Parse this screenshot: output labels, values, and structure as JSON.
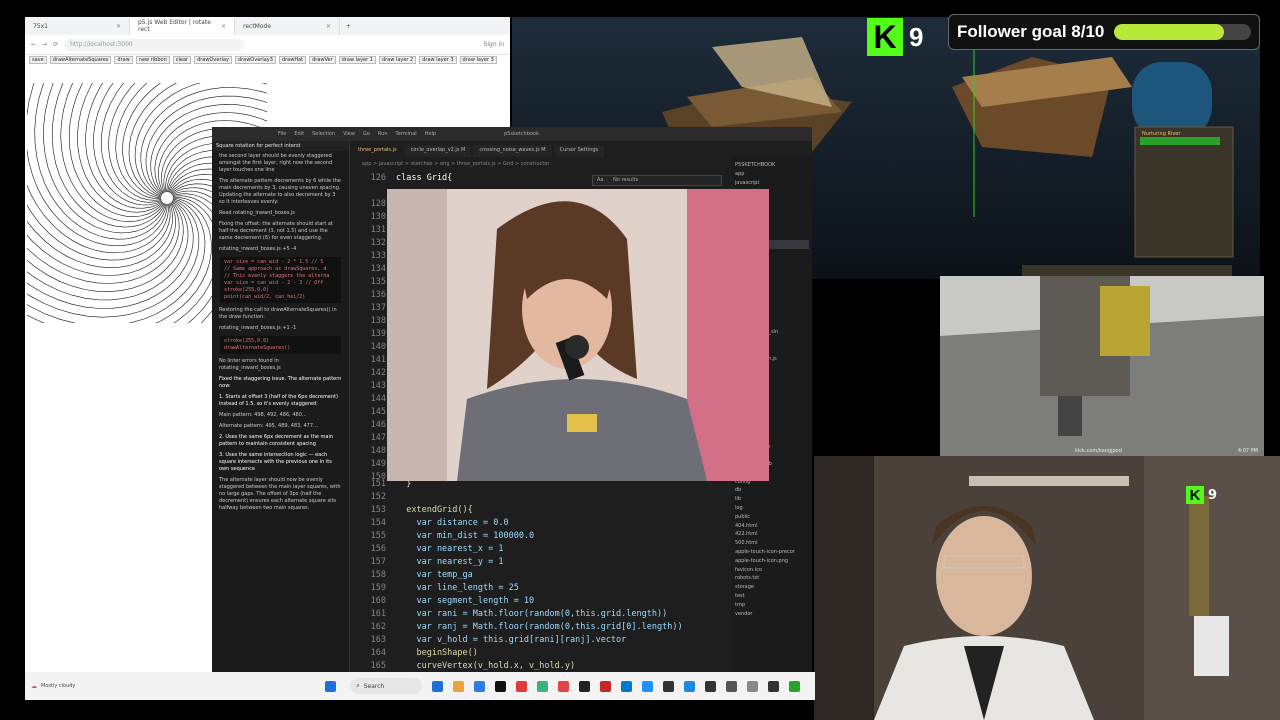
{
  "browser": {
    "tabs": [
      {
        "label": "75x1"
      },
      {
        "label": "p5.js Web Editor | rotate rect"
      },
      {
        "label": "rectMode"
      }
    ],
    "url": "http://localhost:3000",
    "sign_in": "Sign in",
    "buttons": [
      "save",
      "drawAlternateSquares",
      "draw",
      "new ribbon",
      "clear",
      "drawOverlay",
      "drawOverlay3",
      "drawHat",
      "drawVer",
      "draw layer 1",
      "draw layer 2",
      "draw layer 3",
      "draw layer 3"
    ]
  },
  "vscode": {
    "menu": [
      "File",
      "Edit",
      "Selection",
      "View",
      "Go",
      "Run",
      "Terminal",
      "Help"
    ],
    "window_title": "p5sketchbook",
    "chat_title": "Square rotation for perfect interst",
    "tabs": [
      {
        "label": "three_portals.js",
        "active": true
      },
      {
        "label": "circle_overlap_v2.js M",
        "active": false
      },
      {
        "label": "crossing_noise_waves.js M",
        "active": false
      },
      {
        "label": "Cursor Settings",
        "active": false
      }
    ],
    "breadcrumb": "app > javascript > sketches > orig > three_portals.js > Grid > constructor",
    "find": {
      "label": "Aa",
      "result": "No results"
    },
    "chat_messages": [
      "the second layer should be evenly staggered amongst the first layer, right now the second layer touches one line",
      "The alternate pattern decrements by 6 while the main decrements by 3, causing uneven spacing. Updating the alternate to also decrement by 3 so it interleaves evenly:",
      "Read rotating_inward_boxes.js",
      "Fixing the offset: the alternate should start at half the decrement (3, not 1.5) and use the same decrement (6) for even staggering.",
      "rotating_inward_boxes.js +5 -4",
      "Restoring the call to drawAlternateSquares() in the draw function:",
      "rotating_inward_boxes.js +1 -1",
      "No linter errors found in rotating_inward_boxes.js",
      "Fixed the staggering issue. The alternate pattern now:",
      "1. Starts at offset 3 (half of the 6px decrement) instead of 1.5, so it's evenly staggered:",
      "Main pattern: 498, 492, 486, 480...",
      "Alternate pattern: 495, 489, 483, 477...",
      "2. Uses the same 6px decrement as the main pattern to maintain consistent spacing",
      "3. Uses the same intersection logic — each square intersects with the previous one in its own sequence",
      "The alternate layer should now be evenly staggered between the main layer squares, with no large gaps. The offset of 3px (half the decrement) ensures each alternate square sits halfway between two main squares."
    ],
    "chat_code": [
      [
        "var size = can_wid - 2 * 1.5 // S",
        "// Same approach as drawSquares, d",
        "// This evenly staggers the alterna",
        "var size = can_wid - 2 - 3 // Off",
        "stroke(255,0,0)",
        "point(can_wid/2, can_hei/2)"
      ],
      [
        "stroke(255,0,0)",
        "drawAlternateSquares()"
      ]
    ],
    "code_top": {
      "ln": "126",
      "text": "class Grid{"
    },
    "hidden_line_numbers": [
      "128",
      "130",
      "131",
      "132",
      "133",
      "134",
      "135",
      "136",
      "137",
      "138",
      "139",
      "140",
      "141",
      "142",
      "143",
      "144",
      "145",
      "146",
      "147",
      "148",
      "149",
      "150"
    ],
    "code": [
      {
        "ln": "151",
        "text": "  }"
      },
      {
        "ln": "152",
        "text": ""
      },
      {
        "ln": "153",
        "text": "  extendGrid(){"
      },
      {
        "ln": "154",
        "text": "    var distance = 0.0"
      },
      {
        "ln": "155",
        "text": "    var min_dist = 100000.0"
      },
      {
        "ln": "156",
        "text": "    var nearest_x = 1"
      },
      {
        "ln": "157",
        "text": "    var nearest_y = 1"
      },
      {
        "ln": "158",
        "text": "    var temp_ga"
      },
      {
        "ln": "159",
        "text": "    var line_length = 25"
      },
      {
        "ln": "160",
        "text": "    var segment_length = 10"
      },
      {
        "ln": "161",
        "text": "    var rani = Math.floor(random(0,this.grid.length))"
      },
      {
        "ln": "162",
        "text": "    var ranj = Math.floor(random(0,this.grid[0].length))"
      },
      {
        "ln": "163",
        "text": "    var v_hold = this.grid[rani][ranj].vector"
      },
      {
        "ln": "164",
        "text": "    beginShape()"
      },
      {
        "ln": "165",
        "text": "    curveVertex(v_hold.x, v_hold.y)"
      },
      {
        "ln": "166",
        "text": "    for(var n = 0; n < line_length; n++){"
      }
    ],
    "explorer": [
      {
        "label": "P5SKETCHBOOK",
        "cls": ""
      },
      {
        "label": "app",
        "cls": ""
      },
      {
        "label": "javascript",
        "cls": ""
      },
      {
        "label": "",
        "cls": ""
      },
      {
        "label": "",
        "cls": ""
      },
      {
        "label": "",
        "cls": ""
      },
      {
        "label": "",
        "cls": ""
      },
      {
        "label": "_sandbox.js",
        "cls": ""
      },
      {
        "label": "_paths_v1.js",
        "cls": ""
      },
      {
        "label": "_portals.js",
        "cls": "sel"
      },
      {
        "label": "",
        "cls": ""
      },
      {
        "label": "_tor_v1.js",
        "cls": ""
      },
      {
        "label": "_v2.js",
        "cls": ""
      },
      {
        "label": ".js",
        "cls": ""
      },
      {
        "label": "ed1.js",
        "cls": ""
      },
      {
        "label": "noise",
        "cls": ""
      },
      {
        "label": "packing",
        "cls": ""
      },
      {
        "label": "_vid1.js",
        "cls": ""
      },
      {
        "label": "_old.js",
        "cls": ""
      },
      {
        "label": "ground_circle_sin",
        "cls": ""
      },
      {
        "label": "",
        "cls": ""
      },
      {
        "label": "",
        "cls": ""
      },
      {
        "label": "_buffer_sketch.js",
        "cls": ""
      },
      {
        "label": "",
        "cls": ""
      },
      {
        "label": "_on_job.rb",
        "cls": ""
      },
      {
        "label": "",
        "cls": ""
      },
      {
        "label": "",
        "cls": ""
      },
      {
        "label": "",
        "cls": ""
      },
      {
        "label": "",
        "cls": ""
      },
      {
        "label": "html.erb",
        "cls": "red"
      },
      {
        "label": "",
        "cls": ""
      },
      {
        "label": "",
        "cls": ""
      },
      {
        "label": "ation.html.erb",
        "cls": "red"
      },
      {
        "label": "ation.text.erb",
        "cls": ""
      },
      {
        "label": "mailer.text.erb",
        "cls": ""
      },
      {
        "label": "bin",
        "cls": ""
      },
      {
        "label": "config",
        "cls": ""
      },
      {
        "label": "db",
        "cls": ""
      },
      {
        "label": "lib",
        "cls": ""
      },
      {
        "label": "log",
        "cls": ""
      },
      {
        "label": "public",
        "cls": ""
      },
      {
        "label": "404.html",
        "cls": ""
      },
      {
        "label": "422.html",
        "cls": ""
      },
      {
        "label": "500.html",
        "cls": ""
      },
      {
        "label": "apple-touch-icon-precor",
        "cls": ""
      },
      {
        "label": "apple-touch-icon.png",
        "cls": ""
      },
      {
        "label": "favicon.ico",
        "cls": ""
      },
      {
        "label": "robots.txt",
        "cls": ""
      },
      {
        "label": "storage",
        "cls": ""
      },
      {
        "label": "test",
        "cls": ""
      },
      {
        "label": "tmp",
        "cls": ""
      },
      {
        "label": "vendor",
        "cls": ""
      }
    ]
  },
  "stream": {
    "follower_goal": "Follower goal 8/10",
    "follower_progress": 0.8,
    "viewers": "9",
    "webcam_viewers": "9",
    "irl_handle": "kick.com/kangjpod",
    "irl_time": "4:07 PM",
    "game_panel_title": "Nurturing River"
  },
  "taskbar": {
    "weather": "Mostly cloudy",
    "search_placeholder": "Search",
    "icon_colors": [
      "#1f6fd8",
      "#e8a33d",
      "#2b7de9",
      "#111111",
      "#dd3b3b",
      "#36b37e",
      "#e04646",
      "#222222",
      "#c62828",
      "#0078d4",
      "#1e90ff",
      "#333333",
      "#1e88e5",
      "#333333",
      "#555555",
      "#888888",
      "#333333",
      "#2aa12a"
    ]
  },
  "colors": {
    "kick_green": "#53fc18",
    "goal_fill": "#b7e83a"
  }
}
